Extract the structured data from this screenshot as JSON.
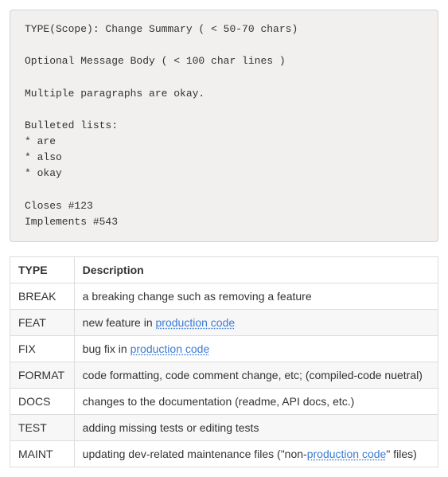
{
  "code_block": {
    "lines": [
      "TYPE(Scope): Change Summary ( < 50-70 chars)",
      "",
      "Optional Message Body ( < 100 char lines )",
      "",
      "Multiple paragraphs are okay.",
      "",
      "Bulleted lists:",
      "* are",
      "* also",
      "* okay",
      "",
      "Closes #123",
      "Implements #543"
    ]
  },
  "table": {
    "headers": {
      "type": "TYPE",
      "description": "Description"
    },
    "rows": [
      {
        "type": "BREAK",
        "parts": [
          {
            "text": "a breaking change such as removing a feature",
            "link": false
          }
        ]
      },
      {
        "type": "FEAT",
        "parts": [
          {
            "text": "new feature in ",
            "link": false
          },
          {
            "text": "production code",
            "link": true
          }
        ]
      },
      {
        "type": "FIX",
        "parts": [
          {
            "text": "bug fix in ",
            "link": false
          },
          {
            "text": "production code",
            "link": true
          }
        ]
      },
      {
        "type": "FORMAT",
        "parts": [
          {
            "text": "code formatting, code comment change, etc; (compiled-code nuetral)",
            "link": false
          }
        ]
      },
      {
        "type": "DOCS",
        "parts": [
          {
            "text": "changes to the documentation (readme, API docs, etc.)",
            "link": false
          }
        ]
      },
      {
        "type": "TEST",
        "parts": [
          {
            "text": "adding missing tests or editing tests",
            "link": false
          }
        ]
      },
      {
        "type": "MAINT",
        "parts": [
          {
            "text": "updating dev-related maintenance files (\"non-",
            "link": false
          },
          {
            "text": "production code",
            "link": true
          },
          {
            "text": "\" files)",
            "link": false
          }
        ]
      }
    ]
  }
}
